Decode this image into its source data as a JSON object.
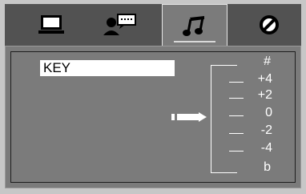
{
  "tabs": [
    {
      "icon": "monitor-icon",
      "active": false
    },
    {
      "icon": "user-speech-icon",
      "active": false
    },
    {
      "icon": "music-note-icon",
      "active": true
    },
    {
      "icon": "no-entry-icon",
      "active": false
    }
  ],
  "panel": {
    "key_label": "KEY",
    "scale": {
      "labels": [
        "#",
        "+4",
        "+2",
        "0",
        "-2",
        "-4",
        "b"
      ],
      "selected": "0"
    }
  }
}
